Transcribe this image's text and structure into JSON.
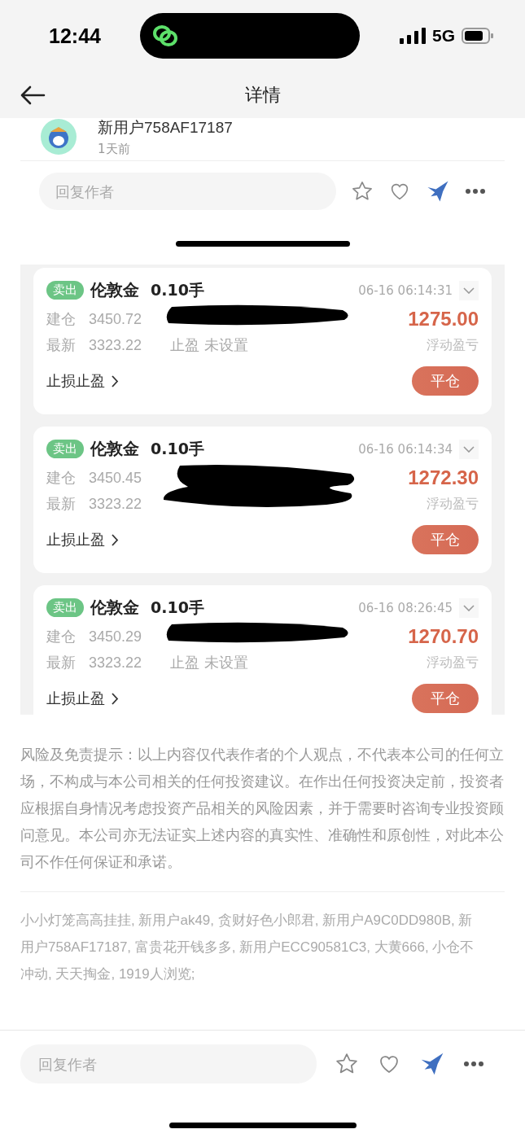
{
  "status_bar": {
    "time": "12:44",
    "network": "5G"
  },
  "header": {
    "title": "详情"
  },
  "post": {
    "author": "新用户758AF17187",
    "time": "1天前",
    "reply_placeholder": "回复作者"
  },
  "positions": [
    {
      "side": "卖出",
      "name": "伦敦金",
      "lots": "0.10手",
      "time": "06-16 06:14:31",
      "open_label": "建仓",
      "open_price": "3450.72",
      "latest_label": "最新",
      "latest_price": "3323.22",
      "tp_label": "止盈",
      "tp_value": "未设置",
      "pnl": "1275.00",
      "pnl_label": "浮动盈亏",
      "sl_link": "止损止盈",
      "close_button": "平仓"
    },
    {
      "side": "卖出",
      "name": "伦敦金",
      "lots": "0.10手",
      "time": "06-16 06:14:34",
      "open_label": "建仓",
      "open_price": "3450.45",
      "latest_label": "最新",
      "latest_price": "3323.22",
      "pnl": "1272.30",
      "pnl_label": "浮动盈亏",
      "sl_link": "止损止盈",
      "close_button": "平仓"
    },
    {
      "side": "卖出",
      "name": "伦敦金",
      "lots": "0.10手",
      "time": "06-16 08:26:45",
      "open_label": "建仓",
      "open_price": "3450.29",
      "latest_label": "最新",
      "latest_price": "3323.22",
      "tp_label": "止盈",
      "tp_value": "未设置",
      "pnl": "1270.70",
      "pnl_label": "浮动盈亏",
      "sl_link": "止损止盈",
      "close_button": "平仓"
    }
  ],
  "disclaimer": "风险及免责提示：以上内容仅代表作者的个人观点，不代表本公司的任何立场，不构成与本公司相关的任何投资建议。在作出任何投资决定前，投资者应根据自身情况考虑投资产品相关的风险因素，并于需要时咨询专业投资顾问意见。本公司亦无法证实上述内容的真实性、准确性和原创性，对此本公司不作任何保证和承诺。",
  "viewers": "小小灯笼高高挂挂, 新用户ak49, 贪财好色小郎君, 新用户A9C0DD980B, 新用户758AF17187, 富贵花开钱多多, 新用户ECC90581C3, 大黄666, 小仓不冲动, 天天掏金, 1919人浏览;",
  "bottom_bar": {
    "reply_placeholder": "回复作者"
  }
}
